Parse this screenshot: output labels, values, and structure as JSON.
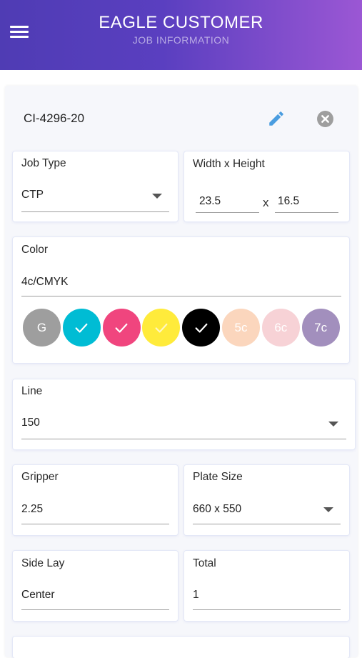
{
  "header": {
    "title": "EAGLE CUSTOMER",
    "subtitle": "JOB INFORMATION"
  },
  "job": {
    "id": "CI-4296-20"
  },
  "job_type": {
    "label": "Job Type",
    "value": "CTP"
  },
  "size": {
    "label": "Width x Height",
    "width": "23.5",
    "separator": "x",
    "height": "16.5"
  },
  "color": {
    "label": "Color",
    "value": "4c/CMYK",
    "swatches": [
      {
        "text": "G",
        "color": "#9e9e9e",
        "checked": false
      },
      {
        "text": "",
        "color": "#00bcd4",
        "checked": true
      },
      {
        "text": "",
        "color": "#f0457e",
        "checked": true
      },
      {
        "text": "",
        "color": "#ffeb3b",
        "checked": true
      },
      {
        "text": "",
        "color": "#000000",
        "checked": true
      },
      {
        "text": "5c",
        "color": "#fbd6bd",
        "checked": false
      },
      {
        "text": "6c",
        "color": "#f7d2d6",
        "checked": false
      },
      {
        "text": "7c",
        "color": "#a28fbd",
        "checked": false
      }
    ]
  },
  "line": {
    "label": "Line",
    "value": "150"
  },
  "gripper": {
    "label": "Gripper",
    "value": "2.25"
  },
  "plate_size": {
    "label": "Plate Size",
    "value": "660 x 550"
  },
  "side_lay": {
    "label": "Side Lay",
    "value": "Center"
  },
  "total": {
    "label": "Total",
    "value": "1"
  },
  "colors": {
    "accent": "#5a3fc0",
    "edit": "#4a9de0",
    "close": "#9e9e9e"
  }
}
